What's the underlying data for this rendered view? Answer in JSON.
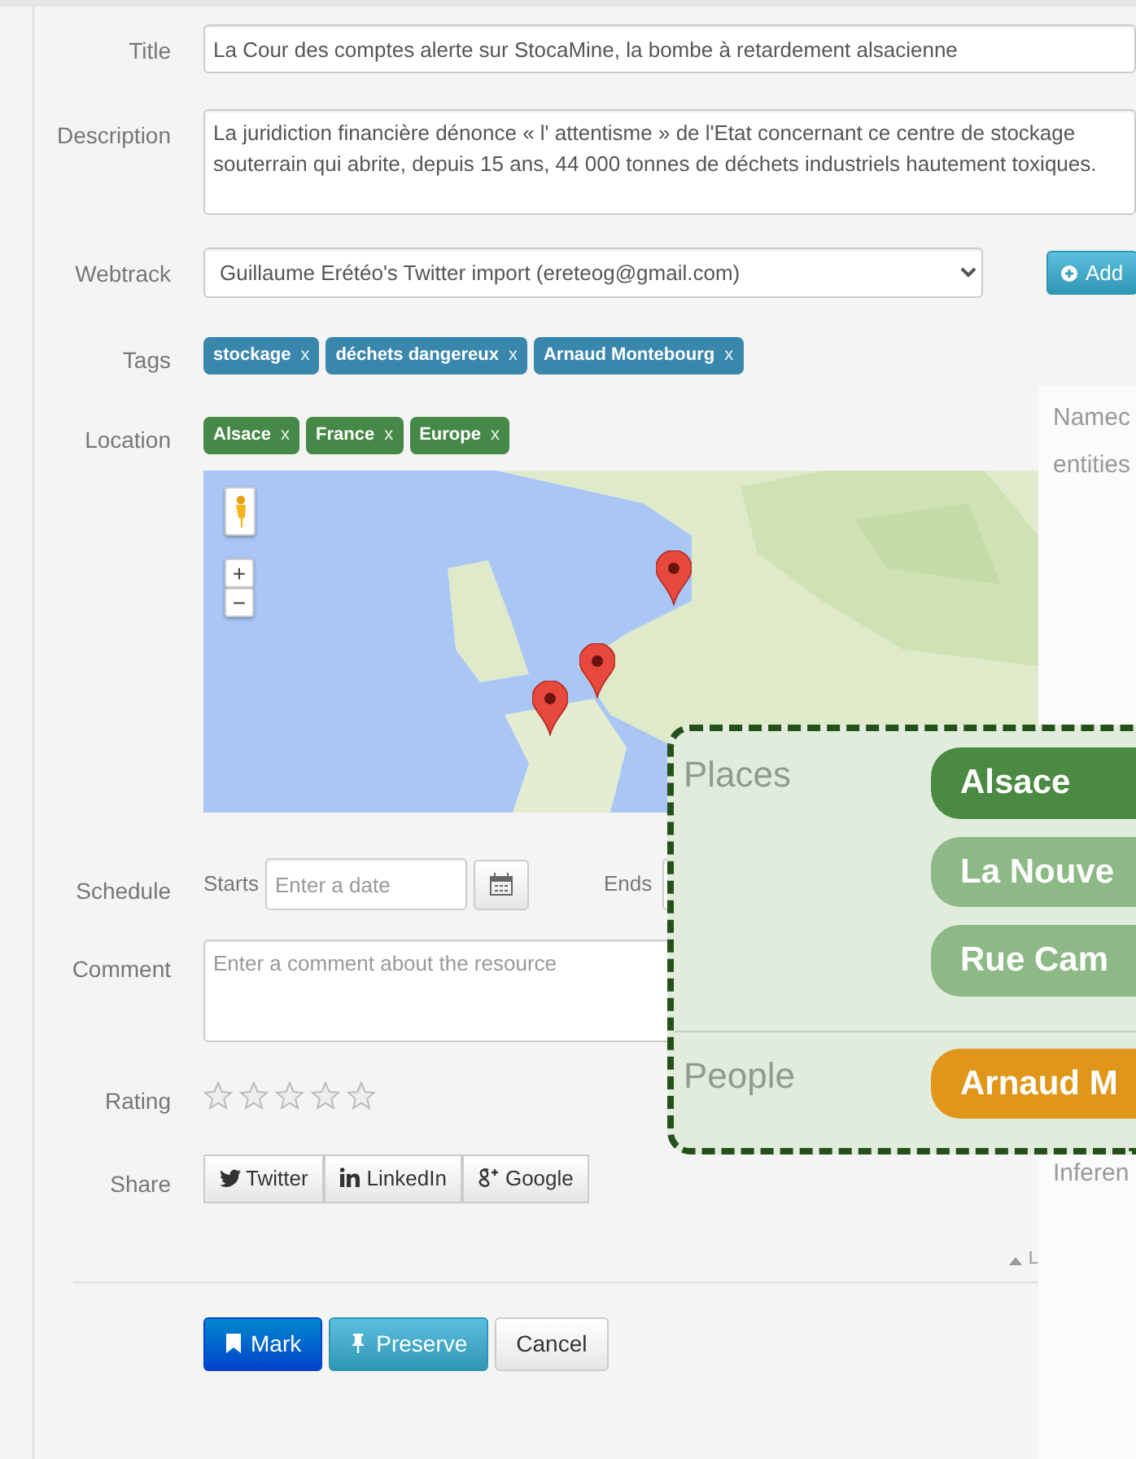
{
  "form": {
    "title": {
      "label": "Title",
      "value": "La Cour des comptes alerte sur StocaMine, la bombe à retardement alsacienne"
    },
    "description": {
      "label": "Description",
      "value": "La juridiction financière dénonce « l' attentisme » de l'Etat concernant ce centre de stockage souterrain qui abrite, depuis 15 ans, 44 000 tonnes de déchets industriels hautement toxiques."
    },
    "webtrack": {
      "label": "Webtrack",
      "value": "Guillaume Erétéo's Twitter import (ereteog@gmail.com)",
      "add_button": "Add"
    },
    "tags": {
      "label": "Tags",
      "items": [
        {
          "text": "stockage",
          "remove": "x"
        },
        {
          "text": "déchets dangereux",
          "remove": "x"
        },
        {
          "text": "Arnaud Montebourg",
          "remove": "x"
        }
      ]
    },
    "location": {
      "label": "Location",
      "items": [
        {
          "text": "Alsace",
          "remove": "x"
        },
        {
          "text": "France",
          "remove": "x"
        },
        {
          "text": "Europe",
          "remove": "x"
        }
      ],
      "map": {
        "kind": "picture",
        "zoom_in": "+",
        "zoom_out": "−"
      }
    },
    "schedule": {
      "label": "Schedule",
      "starts_label": "Starts",
      "starts_placeholder": "Enter a date",
      "ends_label": "Ends"
    },
    "comment": {
      "label": "Comment",
      "placeholder": "Enter a comment about the resource"
    },
    "rating": {
      "label": "Rating",
      "stars": 0
    },
    "share": {
      "label": "Share",
      "buttons": [
        {
          "kind": "twitter",
          "text": "Twitter"
        },
        {
          "kind": "linkedin",
          "text": "LinkedIn"
        },
        {
          "kind": "google",
          "text": "Google"
        }
      ]
    },
    "collapse_link": "L",
    "actions": [
      {
        "kind": "primary",
        "text": "Mark"
      },
      {
        "kind": "info",
        "text": "Preserve"
      },
      {
        "kind": "default",
        "text": "Cancel"
      }
    ]
  },
  "side_panel": {
    "heading_lines": [
      "Namec",
      "entities"
    ],
    "footer": "Inferen"
  },
  "callout": {
    "groups": [
      {
        "label": "Places",
        "items": [
          {
            "text": "Alsace",
            "color": "#4a8a43"
          },
          {
            "text": "La Nouve",
            "color": "#8cb985"
          },
          {
            "text": "Rue Cam",
            "color": "#8cb985"
          }
        ]
      },
      {
        "label": "People",
        "items": [
          {
            "text": "Arnaud M",
            "color": "#e0961a"
          }
        ]
      }
    ]
  }
}
